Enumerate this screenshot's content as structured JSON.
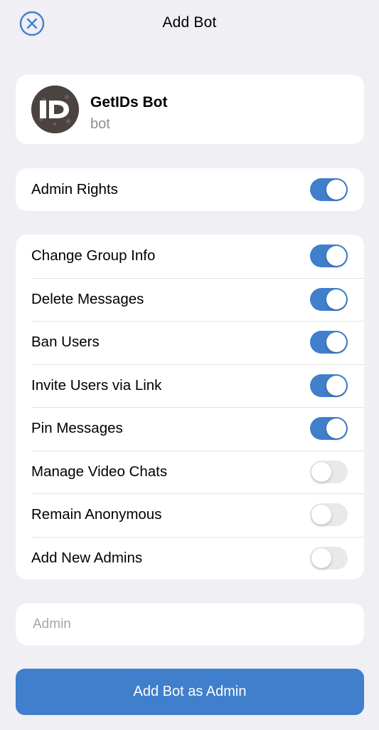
{
  "header": {
    "title": "Add Bot",
    "close_icon": "close-circle-icon"
  },
  "bot": {
    "name": "GetIDs Bot",
    "subtitle": "bot",
    "avatar_icon": "getids-logo-avatar"
  },
  "admin_rights": {
    "label": "Admin Rights",
    "enabled": true
  },
  "permissions": [
    {
      "label": "Change Group Info",
      "enabled": true
    },
    {
      "label": "Delete Messages",
      "enabled": true
    },
    {
      "label": "Ban Users",
      "enabled": true
    },
    {
      "label": "Invite Users via Link",
      "enabled": true
    },
    {
      "label": "Pin Messages",
      "enabled": true
    },
    {
      "label": "Manage Video Chats",
      "enabled": false
    },
    {
      "label": "Remain Anonymous",
      "enabled": false
    },
    {
      "label": "Add New Admins",
      "enabled": false
    }
  ],
  "title_input": {
    "placeholder": "Admin",
    "value": ""
  },
  "submit": {
    "label": "Add Bot as Admin"
  },
  "colors": {
    "accent": "#3f7fcb",
    "background": "#efeff4",
    "toggle_off": "#e9e9eb",
    "secondary_text": "#8e8e93"
  }
}
